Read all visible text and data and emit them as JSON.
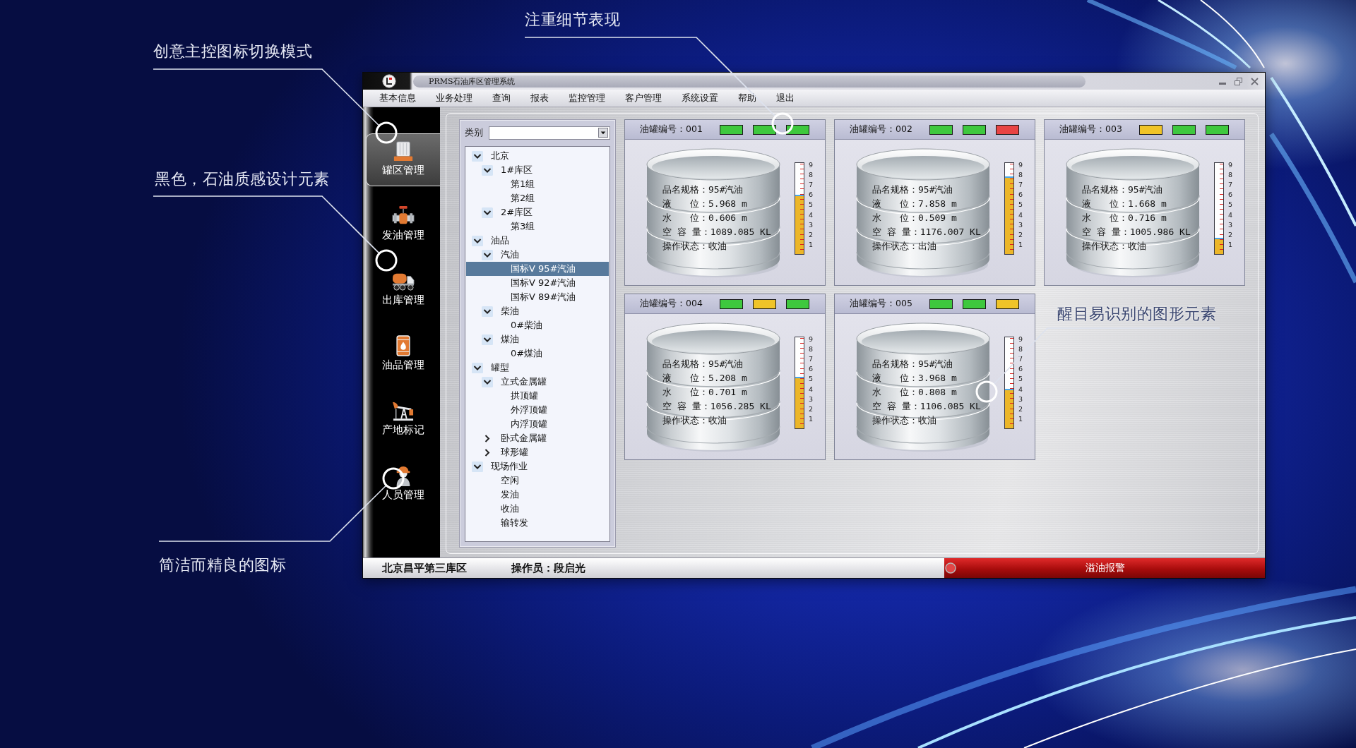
{
  "callouts": [
    {
      "text": "注重细节表现"
    },
    {
      "text": "创意主控图标切换模式"
    },
    {
      "text": "黑色，石油质感设计元素"
    },
    {
      "text": "醒目易识别的图形元素"
    },
    {
      "text": "简洁而精良的图标"
    }
  ],
  "window": {
    "title": "PRMS石油库区管理系统"
  },
  "menu": [
    "基本信息",
    "业务处理",
    "查询",
    "报表",
    "监控管理",
    "客户管理",
    "系统设置",
    "帮助",
    "退出"
  ],
  "sidebar": {
    "items": [
      {
        "label": "罐区管理",
        "selected": true
      },
      {
        "label": "发油管理",
        "selected": false
      },
      {
        "label": "出库管理",
        "selected": false
      },
      {
        "label": "油品管理",
        "selected": false
      },
      {
        "label": "产地标记",
        "selected": false
      },
      {
        "label": "人员管理",
        "selected": false
      }
    ]
  },
  "category_filter": {
    "label": "类别"
  },
  "tree": [
    {
      "label": "北京",
      "expanded": true,
      "selected": false,
      "children": [
        {
          "label": "1#库区",
          "expanded": true,
          "selected": false,
          "children": [
            {
              "label": "第1组",
              "selected": false
            },
            {
              "label": "第2组",
              "selected": false
            }
          ]
        },
        {
          "label": "2#库区",
          "expanded": true,
          "selected": false,
          "children": [
            {
              "label": "第3组",
              "selected": false
            }
          ]
        }
      ]
    },
    {
      "label": "油品",
      "expanded": true,
      "selected": false,
      "children": [
        {
          "label": "汽油",
          "expanded": true,
          "selected": false,
          "children": [
            {
              "label": "国标V 95#汽油",
              "selected": true
            },
            {
              "label": "国标V 92#汽油",
              "selected": false
            },
            {
              "label": "国标V 89#汽油",
              "selected": false
            }
          ]
        },
        {
          "label": "柴油",
          "expanded": true,
          "selected": false,
          "children": [
            {
              "label": "0#柴油",
              "selected": false
            }
          ]
        },
        {
          "label": "煤油",
          "expanded": true,
          "selected": false,
          "children": [
            {
              "label": "0#煤油",
              "selected": false
            }
          ]
        }
      ]
    },
    {
      "label": "罐型",
      "expanded": true,
      "selected": false,
      "children": [
        {
          "label": "立式金属罐",
          "expanded": true,
          "selected": false,
          "children": [
            {
              "label": "拱顶罐",
              "selected": false
            },
            {
              "label": "外浮顶罐",
              "selected": false
            },
            {
              "label": "内浮顶罐",
              "selected": false
            }
          ]
        },
        {
          "label": "卧式金属罐",
          "expanded": false,
          "selected": false
        },
        {
          "label": "球形罐",
          "expanded": false,
          "selected": false
        }
      ]
    },
    {
      "label": "现场作业",
      "expanded": true,
      "selected": false,
      "children": [
        {
          "label": "空闲",
          "selected": false
        },
        {
          "label": "发油",
          "selected": false
        },
        {
          "label": "收油",
          "selected": false
        },
        {
          "label": "输转发",
          "selected": false
        }
      ]
    }
  ],
  "tanks": [
    {
      "title": "油罐编号：001",
      "lights": [
        {
          "color": "#3ec83e"
        },
        {
          "color": "#3ec83e"
        },
        {
          "color": "#3ec83e"
        }
      ],
      "lines": [
        "品名规格：95#汽油",
        "液　　位：5.968 m",
        "水　　位：0.606 m",
        "空 容 量：1089.085 KL",
        "操作状态：收油"
      ],
      "level": 0.649,
      "scale": [
        "9",
        "8",
        "7",
        "6",
        "5",
        "4",
        "3",
        "2",
        "1"
      ]
    },
    {
      "title": "油罐编号：002",
      "lights": [
        {
          "color": "#3ec83e"
        },
        {
          "color": "#3ec83e"
        },
        {
          "color": "#e84444"
        }
      ],
      "lines": [
        "品名规格：95#汽油",
        "液　　位：7.858 m",
        "水　　位：0.509 m",
        "空 容 量：1176.007 KL",
        "操作状态：出油"
      ],
      "level": 0.854,
      "scale": [
        "9",
        "8",
        "7",
        "6",
        "5",
        "4",
        "3",
        "2",
        "1"
      ]
    },
    {
      "title": "油罐编号：003",
      "lights": [
        {
          "color": "#f0c428"
        },
        {
          "color": "#3ec83e"
        },
        {
          "color": "#3ec83e"
        }
      ],
      "lines": [
        "品名规格：95#汽油",
        "液　　位：1.668 m",
        "水　　位：0.716 m",
        "空 容 量：1005.986 KL",
        "操作状态：收油"
      ],
      "level": 0.181,
      "scale": [
        "9",
        "8",
        "7",
        "6",
        "5",
        "4",
        "3",
        "2",
        "1"
      ]
    },
    {
      "title": "油罐编号：004",
      "lights": [
        {
          "color": "#3ec83e"
        },
        {
          "color": "#f0c428"
        },
        {
          "color": "#3ec83e"
        }
      ],
      "lines": [
        "品名规格：95#汽油",
        "液　　位：5.208 m",
        "水　　位：0.701 m",
        "空 容 量：1056.285 KL",
        "操作状态：收油"
      ],
      "level": 0.566,
      "scale": [
        "9",
        "8",
        "7",
        "6",
        "5",
        "4",
        "3",
        "2",
        "1"
      ]
    },
    {
      "title": "油罐编号：005",
      "lights": [
        {
          "color": "#3ec83e"
        },
        {
          "color": "#3ec83e"
        },
        {
          "color": "#f0c428"
        }
      ],
      "lines": [
        "品名规格：95#汽油",
        "液　　位：3.968 m",
        "水　　位：0.808 m",
        "空 容 量：1106.085 KL",
        "操作状态：收油"
      ],
      "level": 0.431,
      "scale": [
        "9",
        "8",
        "7",
        "6",
        "5",
        "4",
        "3",
        "2",
        "1"
      ]
    }
  ],
  "status_bar": {
    "location": "北京昌平第三库区",
    "operator": "操作员：段启光",
    "alarm": "溢油报警"
  }
}
